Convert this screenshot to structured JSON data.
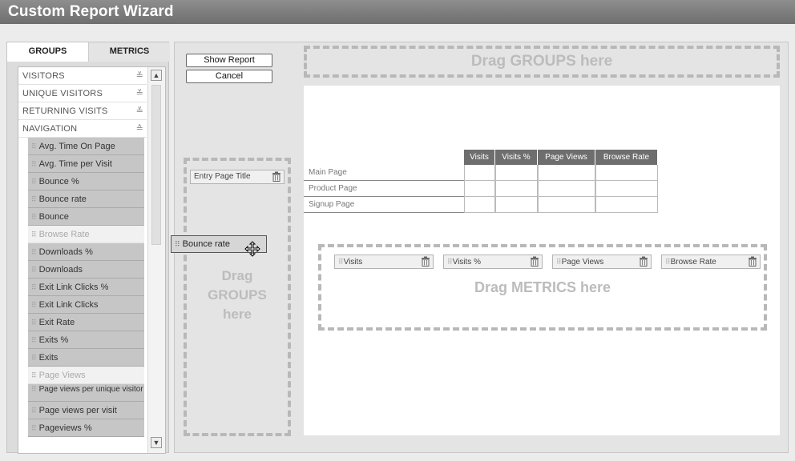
{
  "window": {
    "title": "Custom Report Wizard"
  },
  "tabs": {
    "groups": "GROUPS",
    "metrics": "METRICS"
  },
  "categories": [
    {
      "label": "VISITORS",
      "chev": "≚"
    },
    {
      "label": "UNIQUE VISITORS",
      "chev": "≚"
    },
    {
      "label": "RETURNING VISITS",
      "chev": "≚"
    },
    {
      "label": "NAVIGATION",
      "chev": "≙"
    }
  ],
  "navigation_items": [
    {
      "label": "Avg. Time On Page",
      "disabled": false
    },
    {
      "label": "Avg. Time per Visit",
      "disabled": false
    },
    {
      "label": "Bounce %",
      "disabled": false
    },
    {
      "label": "Bounce rate",
      "disabled": false
    },
    {
      "label": "Bounce",
      "disabled": false
    },
    {
      "label": "Browse Rate",
      "disabled": true
    },
    {
      "label": "Downloads %",
      "disabled": false
    },
    {
      "label": "Downloads",
      "disabled": false
    },
    {
      "label": "Exit Link Clicks %",
      "disabled": false
    },
    {
      "label": "Exit Link Clicks",
      "disabled": false
    },
    {
      "label": "Exit Rate",
      "disabled": false
    },
    {
      "label": "Exits %",
      "disabled": false
    },
    {
      "label": "Exits",
      "disabled": false
    },
    {
      "label": "Page Views",
      "disabled": true
    },
    {
      "label": "Page views per unique visitor",
      "disabled": false,
      "multi": true
    },
    {
      "label": "Page views per visit",
      "disabled": false
    },
    {
      "label": "Pageviews %",
      "disabled": false
    }
  ],
  "buttons": {
    "show_report": "Show Report",
    "cancel": "Cancel"
  },
  "drop_zones": {
    "groups_top": "Drag GROUPS here",
    "groups_side": [
      "Drag",
      "GROUPS",
      "here"
    ],
    "metrics": "Drag METRICS here"
  },
  "group_chip": "Entry Page Title",
  "metric_chips": [
    "Visits",
    "Visits %",
    "Page Views",
    "Browse Rate"
  ],
  "drag_proxy": "Bounce rate",
  "table": {
    "headers": [
      "Visits",
      "Visits %",
      "Page Views",
      "Browse Rate"
    ],
    "rows": [
      "Main Page",
      "Product Page",
      "Signup Page"
    ]
  }
}
